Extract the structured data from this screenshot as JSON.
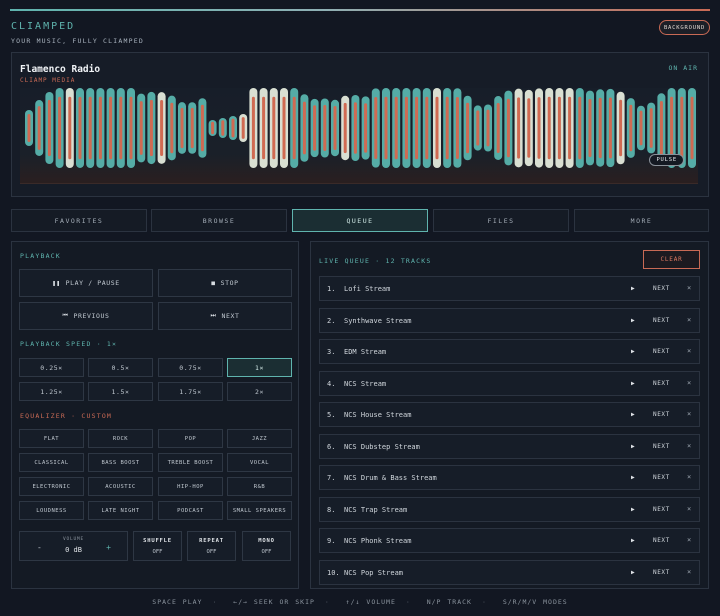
{
  "brand": {
    "title": "CLIAMPED",
    "subtitle": "YOUR MUSIC, FULLY CLIAMPED"
  },
  "background_button": "BACKGROUND",
  "player": {
    "station": "Flamenco Radio",
    "artist": "CLIAMP MEDIA",
    "status": "ON AIR",
    "visualizer_mode": "PULSE"
  },
  "tabs": [
    {
      "label": "FAVORITES"
    },
    {
      "label": "BROWSE"
    },
    {
      "label": "QUEUE"
    },
    {
      "label": "FILES"
    },
    {
      "label": "MORE"
    }
  ],
  "active_tab": "QUEUE",
  "playback": {
    "title": "PLAYBACK",
    "play_pause": "PLAY / PAUSE",
    "stop": "STOP",
    "previous": "PREVIOUS",
    "next": "NEXT"
  },
  "speed": {
    "title": "PLAYBACK SPEED  ·  1×",
    "options": [
      "0.25×",
      "0.5×",
      "0.75×",
      "1×",
      "1.25×",
      "1.5×",
      "1.75×",
      "2×"
    ],
    "selected": "1×"
  },
  "equalizer": {
    "title": "EQUALIZER  ·  CUSTOM",
    "presets": [
      "FLAT",
      "ROCK",
      "POP",
      "JAZZ",
      "CLASSICAL",
      "BASS BOOST",
      "TREBLE BOOST",
      "VOCAL",
      "ELECTRONIC",
      "ACOUSTIC",
      "HIP-HOP",
      "R&B",
      "LOUDNESS",
      "LATE NIGHT",
      "PODCAST",
      "SMALL SPEAKERS"
    ]
  },
  "volume": {
    "label": "VOLUME",
    "value": "0 dB",
    "minus": "-",
    "plus": "+"
  },
  "toggles": [
    {
      "label": "SHUFFLE",
      "value": "OFF"
    },
    {
      "label": "REPEAT",
      "value": "OFF"
    },
    {
      "label": "MONO",
      "value": "OFF"
    }
  ],
  "queue": {
    "title": "LIVE QUEUE  ·  12 TRACKS",
    "clear": "CLEAR",
    "next_label": "NEXT",
    "items": [
      {
        "num": "1.",
        "name": "Lofi Stream"
      },
      {
        "num": "2.",
        "name": "Synthwave Stream"
      },
      {
        "num": "3.",
        "name": "EDM Stream"
      },
      {
        "num": "4.",
        "name": "NCS Stream"
      },
      {
        "num": "5.",
        "name": "NCS House Stream"
      },
      {
        "num": "6.",
        "name": "NCS Dubstep Stream"
      },
      {
        "num": "7.",
        "name": "NCS Drum & Bass Stream"
      },
      {
        "num": "8.",
        "name": "NCS Trap Stream"
      },
      {
        "num": "9.",
        "name": "NCS Phonk Stream"
      },
      {
        "num": "10.",
        "name": "NCS Pop Stream"
      }
    ]
  },
  "footer": {
    "hints": [
      "SPACE PLAY",
      "←/→ SEEK OR SKIP",
      "↑/↓ VOLUME",
      "N/P TRACK",
      "S/R/M/V MODES"
    ]
  },
  "colors": {
    "accent": "#5fb4ae",
    "warm": "#c96a55",
    "background": "#121722"
  },
  "icons": {
    "play_pause": "pause-icon",
    "stop": "stop-icon",
    "previous": "previous-icon",
    "next": "next-icon",
    "row_play": "play-icon",
    "row_remove": "close-icon"
  }
}
